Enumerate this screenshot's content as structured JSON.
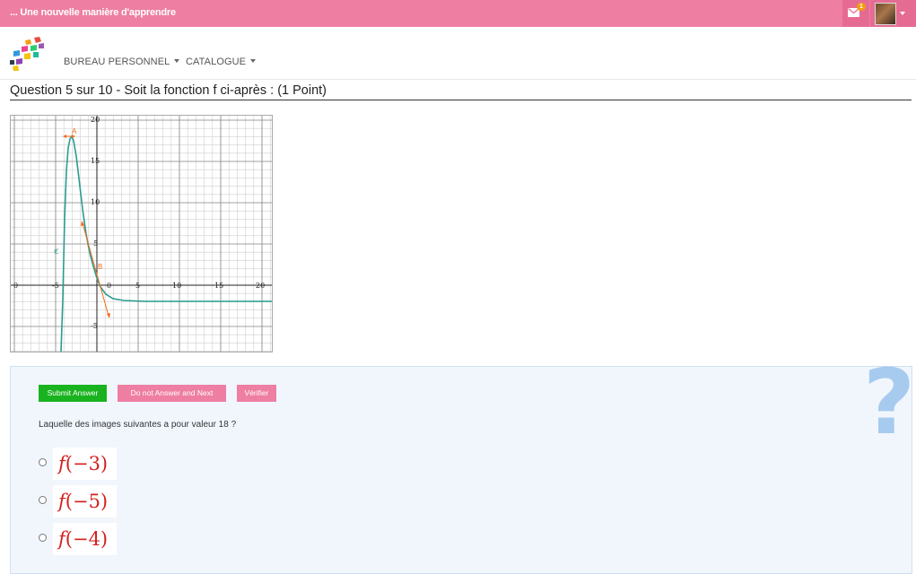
{
  "topbar": {
    "brand": "... Une nouvelle manière d'apprendre",
    "mail_badge": "1",
    "mail_icon": "envelope-icon",
    "colors": {
      "bar": "#ee7ea2",
      "badge": "#f39c12"
    }
  },
  "nav": {
    "items": [
      {
        "label": "BUREAU PERSONNEL"
      },
      {
        "label": "CATALOGUE"
      }
    ]
  },
  "question": {
    "title": "Question 5 sur 10 - Soit la fonction f ci-après : (1 Point)"
  },
  "graph": {
    "x_ticks": [
      "0",
      "-5",
      "0",
      "5",
      "10",
      "15",
      "20"
    ],
    "y_ticks": [
      "20",
      "15",
      "10",
      "5",
      "-5"
    ],
    "point_labels": [
      "A",
      "B"
    ],
    "curve_label": "ℭ",
    "curve_color": "#2a9d8f",
    "arrow_color": "#f26b1d"
  },
  "answer_panel": {
    "buttons": {
      "submit": "Submit Answer",
      "skip": "Do not Answer and Next",
      "verify": "Vérifier"
    },
    "button_colors": {
      "submit": "#19b31f",
      "skip": "#ee7ea2",
      "verify": "#ee7ea2"
    },
    "prompt": "Laquelle des images suivantes a pour valeur 18 ?",
    "help_icon": "?",
    "options": [
      {
        "fn": "f",
        "arg": "(−3)"
      },
      {
        "fn": "f",
        "arg": "(−5)"
      },
      {
        "fn": "f",
        "arg": "(−4)"
      }
    ]
  }
}
